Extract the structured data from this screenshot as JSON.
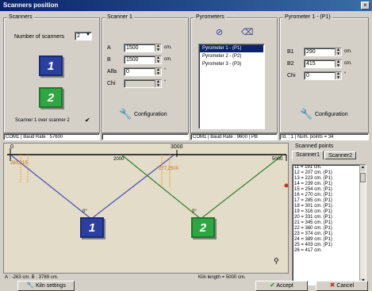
{
  "window": {
    "title": "Scanners position"
  },
  "scanners": {
    "group_label": "Scanners",
    "number_label": "Number of scanners",
    "number_value": "2",
    "scanner1_label": "1",
    "scanner2_label": "2",
    "over_label": "Scanner 1 over scanner 2",
    "over_checked": true,
    "status": "COM1 | Baud Rate : 57600"
  },
  "scanner1": {
    "group_label": "Scanner 1",
    "fields": [
      {
        "label": "A",
        "value": "1500",
        "unit": "cm."
      },
      {
        "label": "B",
        "value": "1500",
        "unit": "cm."
      },
      {
        "label": "Alfa",
        "value": "0",
        "unit": "°"
      },
      {
        "label": "Chi",
        "value": "",
        "unit": "°"
      }
    ],
    "config_label": "Configuration"
  },
  "pyrometers": {
    "group_label": "Pyrometers",
    "items": [
      "Pyrometer 1 - (P1)",
      "Pyrometer 2 - (P2)",
      "Pyrometer 3 - (P3)"
    ],
    "selected_index": 0,
    "status": "COM1 | Baud Rate : 9600 | PB"
  },
  "pyrometer1": {
    "group_label": "Pyrometer 1 - (P1)",
    "fields": [
      {
        "label": "B1",
        "value": "290",
        "unit": "cm."
      },
      {
        "label": "B2",
        "value": "415",
        "unit": "cm."
      },
      {
        "label": "Chi",
        "value": "0",
        "unit": "°"
      }
    ],
    "config_label": "Configuration",
    "status": "Id. : 1 | Num. points = 34"
  },
  "kiln": {
    "scale_left": "0",
    "scale_mid1": "2000",
    "scale_mid2": "3000",
    "scale_right": "5000",
    "marker_left": "263,315",
    "marker_right": "277,2500",
    "angle1": "0°",
    "angle2": "0°",
    "scanner1_label": "1",
    "scanner2_label": "2",
    "coords_text": "A : -263 cm.  B : 3789 cm.",
    "length_text": "Kiln length = 5000 cm."
  },
  "scanned_points": {
    "group_label": "Scanned points",
    "tabs": [
      "Scanner1",
      "Scanner2"
    ],
    "active_tab": 0,
    "items": [
      "11 = 191 cm.",
      "12 = 207 cm. (P1)",
      "13 = 223 cm. (P1)",
      "14 = 239 cm. (P1)",
      "15 = 254 cm. (P1)",
      "16 = 270 cm. (P1)",
      "17 = 285 cm. (P1)",
      "18 = 301 cm. (P1)",
      "19 = 316 cm. (P1)",
      "20 = 331 cm. (P1)",
      "21 = 345 cm. (P1)",
      "22 = 360 cm. (P1)",
      "23 = 374 cm. (P1)",
      "24 = 389 cm. (P1)",
      "25 = 403 cm. (P1)",
      "26 = 417 cm."
    ]
  },
  "bottom": {
    "kiln_settings": "Kiln settings",
    "accept": "Accept",
    "cancel": "Cancel"
  },
  "colors": {
    "title_bar": "#0a246a",
    "scanner_box": "#2b3f9e",
    "scanner_box_green": "#2fa641",
    "line_blue": "#4a4ab8",
    "line_green": "#2f7f2f",
    "marker_orange": "#f0a030",
    "selection": "#0a246a"
  }
}
